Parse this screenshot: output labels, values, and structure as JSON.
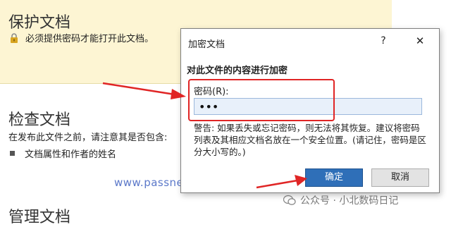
{
  "background": {
    "protect": {
      "title": "保护文档",
      "description": "必须提供密码才能打开此文档。"
    },
    "inspect": {
      "title": "检查文档",
      "description": "在发布此文件之前，请注意其是否包含:",
      "bullet": "文档属性和作者的姓名"
    },
    "manage": {
      "title": "管理文档"
    }
  },
  "dialog": {
    "title": "加密文档",
    "help": "?",
    "close": "✕",
    "heading": "对此文件的内容进行加密",
    "password_label": "密码(R):",
    "password_value": "•••",
    "warning": "警告: 如果丢失或忘记密码，则无法将其恢复。建议将密码列表及其相应文档名放在一个安全位置。(请记住，密码是区分大小写的。)",
    "ok_label": "确定",
    "cancel_label": "取消"
  },
  "watermarks": {
    "url": "www.passneo.com",
    "wechat": "公众号 · 小北数码日记"
  },
  "colors": {
    "protect_bg": "#fdf5d3",
    "ok_button": "#2f6fb8",
    "annotation_red": "#e02525"
  }
}
